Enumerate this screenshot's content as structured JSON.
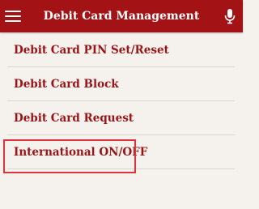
{
  "header": {
    "title": "Debit Card Management",
    "menu_icon": "hamburger-menu-icon",
    "mic_icon": "microphone-icon"
  },
  "menu": {
    "items": [
      {
        "label": "Debit Card PIN Set/Reset"
      },
      {
        "label": "Debit Card Block"
      },
      {
        "label": "Debit Card Request"
      },
      {
        "label": "International ON/OFF"
      }
    ]
  },
  "colors": {
    "header_bg": "#a31316",
    "item_text": "#9a1316",
    "page_bg": "#f5f2ee",
    "highlight_border": "#e0323a"
  }
}
